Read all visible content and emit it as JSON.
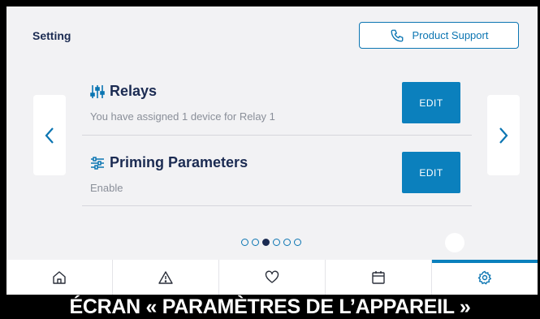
{
  "header": {
    "title": "Setting",
    "support_label": "Product Support"
  },
  "cards": [
    {
      "title": "Relays",
      "subtitle": "You have assigned 1 device for Relay 1",
      "button": "EDIT",
      "icon": "relay-sliders-icon"
    },
    {
      "title": "Priming Parameters",
      "subtitle": "Enable",
      "button": "EDIT",
      "icon": "priming-sliders-icon"
    }
  ],
  "pagination": {
    "total": 6,
    "current": 3
  },
  "tabbar": {
    "items": [
      {
        "name": "home",
        "icon": "home-icon"
      },
      {
        "name": "alerts",
        "icon": "warning-icon"
      },
      {
        "name": "favorites",
        "icon": "heart-icon"
      },
      {
        "name": "schedule",
        "icon": "calendar-icon"
      },
      {
        "name": "settings",
        "icon": "gear-icon",
        "active": true
      }
    ]
  },
  "caption": "ÉCRAN « PARAMÈTRES DE L’APPAREIL »",
  "colors": {
    "accent": "#0b80bd",
    "navy": "#1b2b52",
    "background": "#f2f2f4"
  }
}
